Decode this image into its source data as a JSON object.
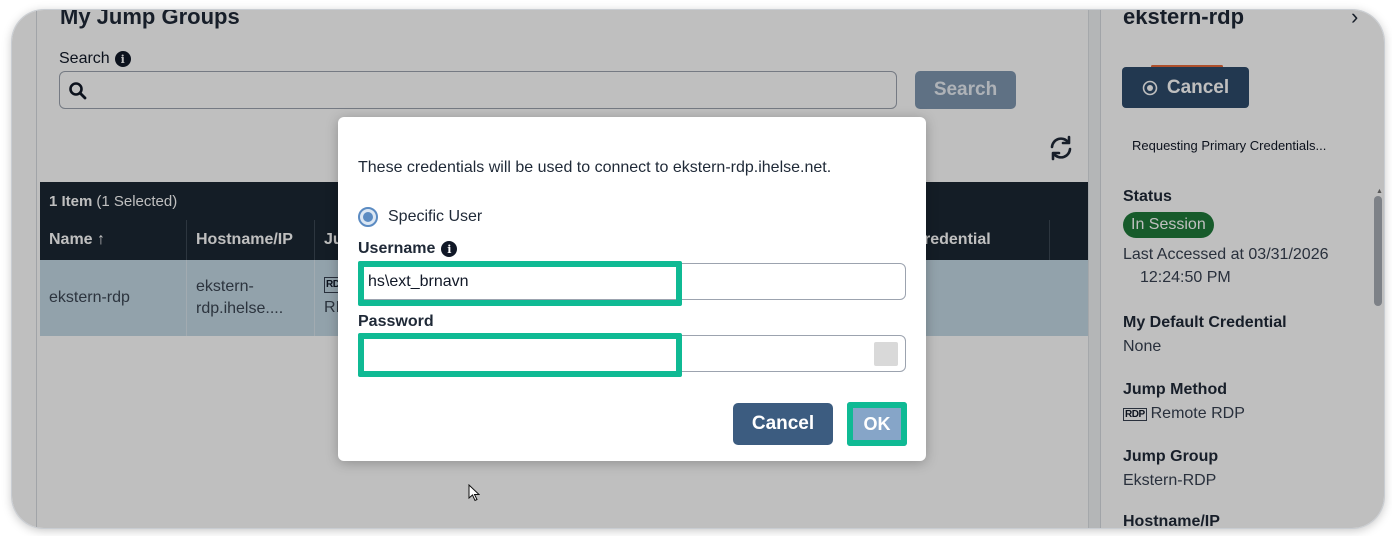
{
  "main": {
    "section_title": "My Jump Groups",
    "search_label": "Search",
    "search_placeholder": "",
    "search_button": "Search",
    "table": {
      "item_count": "1 Item",
      "selected_text": "(1 Selected)",
      "columns": [
        "Name ↑",
        "Hostname/IP",
        "Ju",
        "redential"
      ],
      "rows": [
        {
          "name": "ekstern-rdp",
          "hostname_line1": "ekstern-",
          "hostname_line2": "rdp.ihelse....",
          "method_icon": "RD",
          "method_text": "RI"
        }
      ]
    }
  },
  "side": {
    "title": "ekstern-rdp",
    "chevron": "›",
    "cancel_label": "Cancel",
    "note": "Requesting Primary Credentials...",
    "status_label": "Status",
    "status_badge": "In Session",
    "last_accessed_line1": "Last Accessed at 03/31/2026",
    "last_accessed_line2": "12:24:50 PM",
    "default_credential_label": "My Default Credential",
    "default_credential_value": "None",
    "jump_method_label": "Jump Method",
    "jump_method_icon": "RDP",
    "jump_method_value": "Remote RDP",
    "jump_group_label": "Jump Group",
    "jump_group_value": "Ekstern-RDP",
    "hostname_label": "Hostname/IP"
  },
  "dialog": {
    "message": "These credentials will be used to connect to ekstern-rdp.ihelse.net.",
    "radio_label": "Specific User",
    "username_label": "Username",
    "username_value": "hs\\ext_brnavn",
    "password_label": "Password",
    "password_value": "",
    "cancel_label": "Cancel",
    "ok_label": "OK"
  },
  "colors": {
    "highlight": "#0fba94",
    "primary_button": "#3c5c80",
    "header_bg": "#1b2733",
    "selected_row": "#c3d8e5",
    "status_green": "#1f7a3a"
  }
}
